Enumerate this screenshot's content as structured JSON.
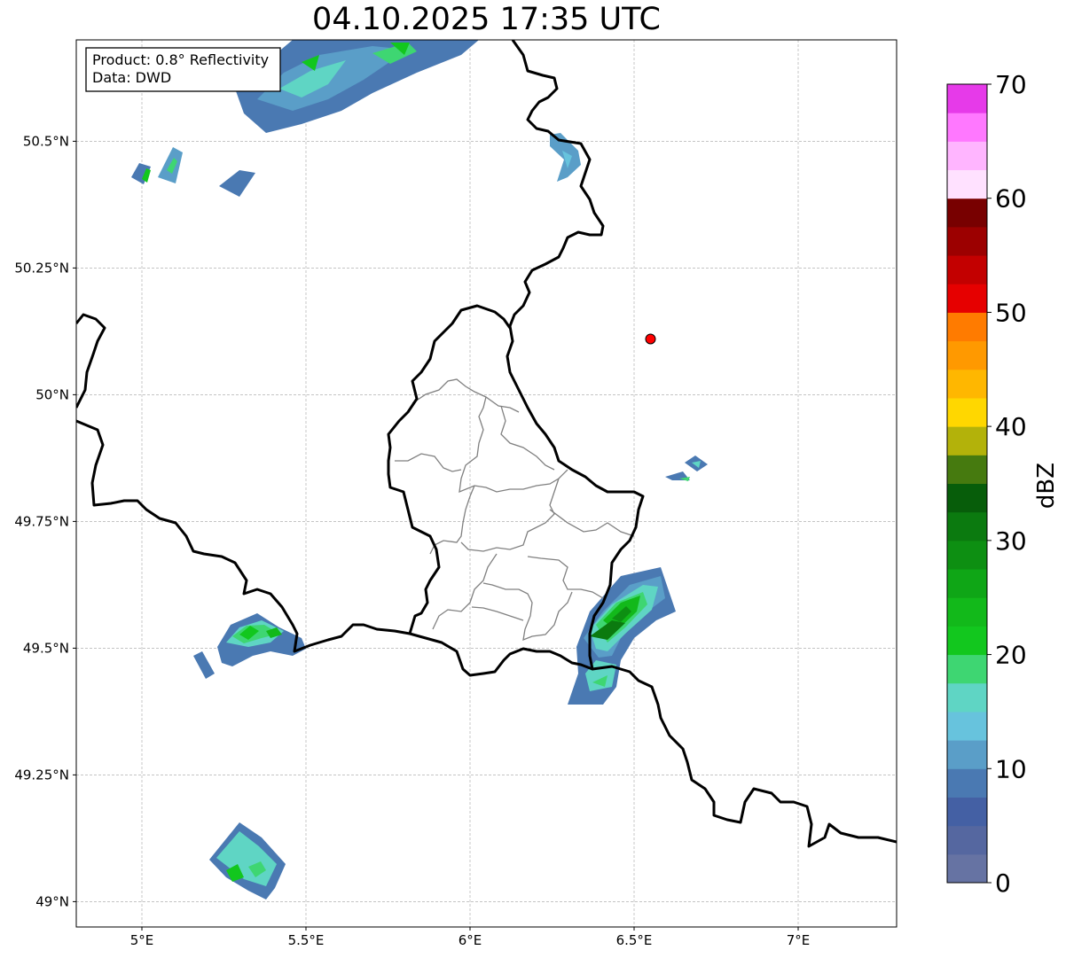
{
  "title": "04.10.2025 17:35 UTC",
  "info_box": {
    "line1": "Product: 0.8° Reflectivity",
    "line2": "Data: DWD"
  },
  "map": {
    "lon_range": [
      4.8,
      7.3
    ],
    "lat_range": [
      48.95,
      50.7
    ],
    "x_ticks": [
      "5°E",
      "5.5°E",
      "6°E",
      "6.5°E",
      "7°E"
    ],
    "x_tick_values": [
      5.0,
      5.5,
      6.0,
      6.5,
      7.0
    ],
    "y_ticks": [
      "49°N",
      "49.25°N",
      "49.5°N",
      "49.75°N",
      "50°N",
      "50.25°N",
      "50.5°N"
    ],
    "y_tick_values": [
      49.0,
      49.25,
      49.5,
      49.75,
      50.0,
      50.25,
      50.5
    ],
    "grid": true,
    "radar_site": {
      "lon": 6.55,
      "lat": 50.11,
      "color": "#ff0000"
    }
  },
  "colorbar": {
    "label": "dBZ",
    "ticks": [
      "0",
      "10",
      "20",
      "30",
      "40",
      "50",
      "60",
      "70"
    ],
    "tick_values": [
      0,
      10,
      20,
      30,
      40,
      50,
      60,
      70
    ],
    "min": 0,
    "max": 70,
    "step": 2.5,
    "colors": [
      "#6673a3",
      "#5567a0",
      "#4460a4",
      "#4a79b2",
      "#5a9ec8",
      "#67c3dd",
      "#5fd5c4",
      "#3ed672",
      "#12c71e",
      "#12b91a",
      "#0fa616",
      "#0d8f12",
      "#0b7a0f",
      "#075d0a",
      "#467a0f",
      "#b3b20a",
      "#ffd700",
      "#ffb700",
      "#ff9900",
      "#ff7b00",
      "#e60000",
      "#c30000",
      "#9c0000",
      "#780000",
      "#ffe1ff",
      "#ffb5ff",
      "#ff78ff",
      "#e63ae9"
    ]
  },
  "colors": {
    "border": "#000000",
    "district": "#808080",
    "grid": "#b0b0b0"
  }
}
